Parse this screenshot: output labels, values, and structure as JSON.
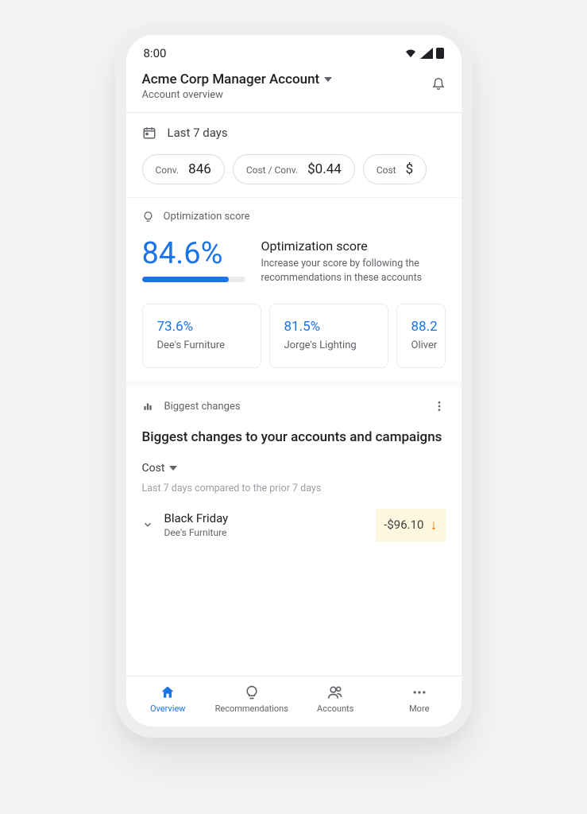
{
  "status": {
    "time": "8:00"
  },
  "header": {
    "account_name": "Acme Corp Manager Account",
    "subtitle": "Account overview"
  },
  "date_range": {
    "label": "Last 7 days"
  },
  "metrics": [
    {
      "label": "Conv.",
      "value": "846"
    },
    {
      "label": "Cost / Conv.",
      "value": "$0.44"
    },
    {
      "label": "Cost",
      "value": "$"
    }
  ],
  "optimization": {
    "section_label": "Optimization score",
    "score": "84.6%",
    "score_fill_pct": 84.6,
    "title": "Optimization score",
    "description": "Increase your score by following the recommendations in these accounts",
    "accounts": [
      {
        "pct": "73.6%",
        "name": "Dee's Furniture"
      },
      {
        "pct": "81.5%",
        "name": "Jorge's Lighting"
      },
      {
        "pct": "88.2",
        "name": "Oliver"
      }
    ]
  },
  "changes": {
    "section_label": "Biggest changes",
    "title": "Biggest changes to your accounts and campaigns",
    "dropdown_label": "Cost",
    "compare_text": "Last 7 days compared to the prior 7 days",
    "rows": [
      {
        "name": "Black Friday",
        "sub": "Dee's Furniture",
        "value": "-$96.10"
      }
    ]
  },
  "nav": {
    "overview": "Overview",
    "recommendations": "Recommendations",
    "accounts": "Accounts",
    "more": "More"
  }
}
